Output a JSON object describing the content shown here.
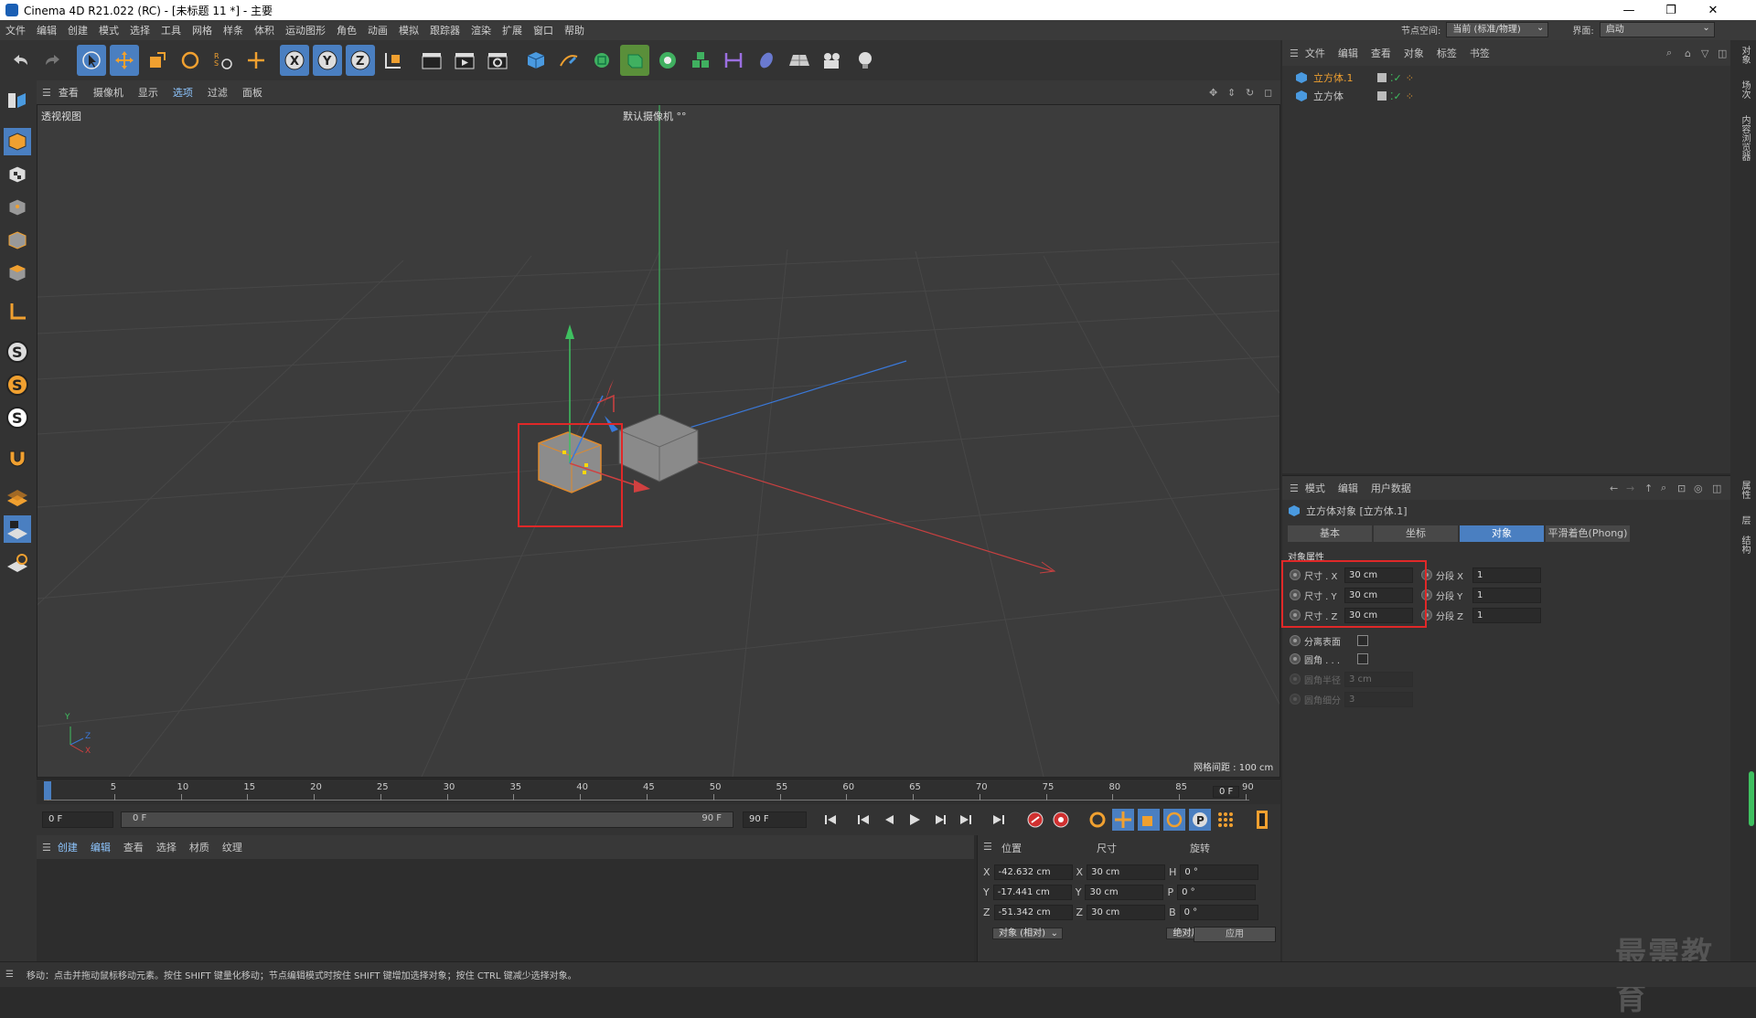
{
  "window": {
    "title": "Cinema 4D R21.022 (RC) - [未标题 11 *] - 主要",
    "min": "—",
    "restore": "❐",
    "close": "✕"
  },
  "menu": {
    "items": [
      "文件",
      "编辑",
      "创建",
      "模式",
      "选择",
      "工具",
      "网格",
      "样条",
      "体积",
      "运动图形",
      "角色",
      "动画",
      "模拟",
      "跟踪器",
      "渲染",
      "扩展",
      "窗口",
      "帮助"
    ],
    "node_space_label": "节点空间:",
    "node_space_value": "当前 (标准/物理)",
    "layout_label": "界面:",
    "layout_value": "启动"
  },
  "viewport": {
    "menu": [
      "查看",
      "摄像机",
      "显示",
      "选项",
      "过滤",
      "面板"
    ],
    "view_name": "透视视图",
    "camera_name": "默认摄像机 °°",
    "grid_spacing": "网格间距 : 100 cm",
    "axis_y": "Y",
    "axis_z": "Z",
    "axis_x": "X"
  },
  "timeline": {
    "ticks": [
      "0",
      "5",
      "10",
      "15",
      "20",
      "25",
      "30",
      "35",
      "40",
      "45",
      "50",
      "55",
      "60",
      "65",
      "70",
      "75",
      "80",
      "85",
      "90"
    ],
    "current_frame": "0 F"
  },
  "playbar": {
    "start": "0 F",
    "range_start": "0 F",
    "range_end": "90 F",
    "end": "90 F"
  },
  "material_bar": {
    "menu": [
      "创建",
      "编辑",
      "查看",
      "选择",
      "材质",
      "纹理"
    ]
  },
  "coords": {
    "headers": [
      "位置",
      "尺寸",
      "旋转"
    ],
    "rows": [
      {
        "axis": "X",
        "pos": "-42.632 cm",
        "size_axis": "X",
        "size": "30 cm",
        "rot_axis": "H",
        "rot": "0 °"
      },
      {
        "axis": "Y",
        "pos": "-17.441 cm",
        "size_axis": "Y",
        "size": "30 cm",
        "rot_axis": "P",
        "rot": "0 °"
      },
      {
        "axis": "Z",
        "pos": "-51.342 cm",
        "size_axis": "Z",
        "size": "30 cm",
        "rot_axis": "B",
        "rot": "0 °"
      }
    ],
    "mode": "对象 (相对)",
    "size_mode": "绝对尺寸",
    "apply": "应用"
  },
  "object_manager": {
    "menu": [
      "文件",
      "编辑",
      "查看",
      "对象",
      "标签",
      "书签"
    ],
    "objects": [
      {
        "name": "立方体.1",
        "selected": true
      },
      {
        "name": "立方体",
        "selected": false
      }
    ]
  },
  "attributes": {
    "menu": [
      "模式",
      "编辑",
      "用户数据"
    ],
    "title": "立方体对象 [立方体.1]",
    "tabs": [
      "基本",
      "坐标",
      "对象",
      "平滑着色(Phong)"
    ],
    "active_tab": 2,
    "section": "对象属性",
    "size": [
      {
        "label": "尺寸 . X",
        "value": "30 cm"
      },
      {
        "label": "尺寸 . Y",
        "value": "30 cm"
      },
      {
        "label": "尺寸 . Z",
        "value": "30 cm"
      }
    ],
    "segments": [
      {
        "label": "分段 X",
        "value": "1"
      },
      {
        "label": "分段 Y",
        "value": "1"
      },
      {
        "label": "分段 Z",
        "value": "1"
      }
    ],
    "separate_surfaces": "分离表面",
    "fillet": "圆角 . . .",
    "fillet_radius_label": "圆角半径",
    "fillet_radius": "3 cm",
    "fillet_subdiv_label": "圆角细分",
    "fillet_subdiv": "3"
  },
  "right_strip": [
    "对象",
    "场次",
    "内容浏览器",
    "属性",
    "层",
    "结构"
  ],
  "status": "移动：点击并拖动鼠标移动元素。按住 SHIFT 键量化移动；节点编辑模式时按住 SHIFT 键增加选择对象；按住 CTRL 键减少选择对象。",
  "watermark": "最需教育",
  "colors": {
    "accent_blue": "#4a7fc1",
    "highlight_red": "#e02828",
    "x_axis": "#d04040",
    "y_axis": "#40c060",
    "z_axis": "#3a78d8",
    "selection_orange": "#e08a2c"
  }
}
